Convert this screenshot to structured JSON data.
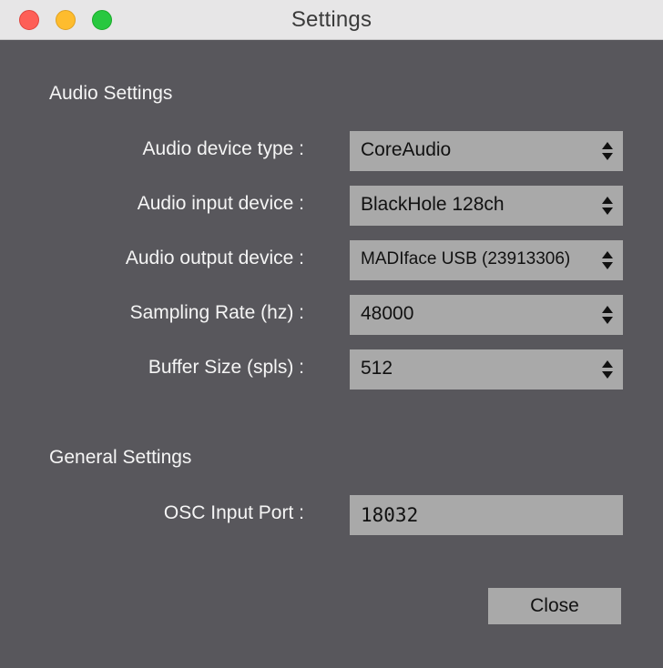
{
  "window": {
    "title": "Settings"
  },
  "audio_settings": {
    "heading": "Audio Settings",
    "rows": [
      {
        "label": "Audio device type :",
        "value": "CoreAudio"
      },
      {
        "label": "Audio input device :",
        "value": "BlackHole 128ch"
      },
      {
        "label": "Audio output device :",
        "value": "MADIface USB (23913306)"
      },
      {
        "label": "Sampling Rate (hz) :",
        "value": "48000"
      },
      {
        "label": "Buffer Size (spls) :",
        "value": "512"
      }
    ]
  },
  "general_settings": {
    "heading": "General Settings",
    "osc_label": "OSC Input Port :",
    "osc_value": "18032"
  },
  "buttons": {
    "close_label": "Close"
  },
  "colors": {
    "background": "#58575c",
    "control": "#a9a9a9",
    "label_text": "#f5f5f5",
    "titlebar": "#e7e6e7"
  }
}
